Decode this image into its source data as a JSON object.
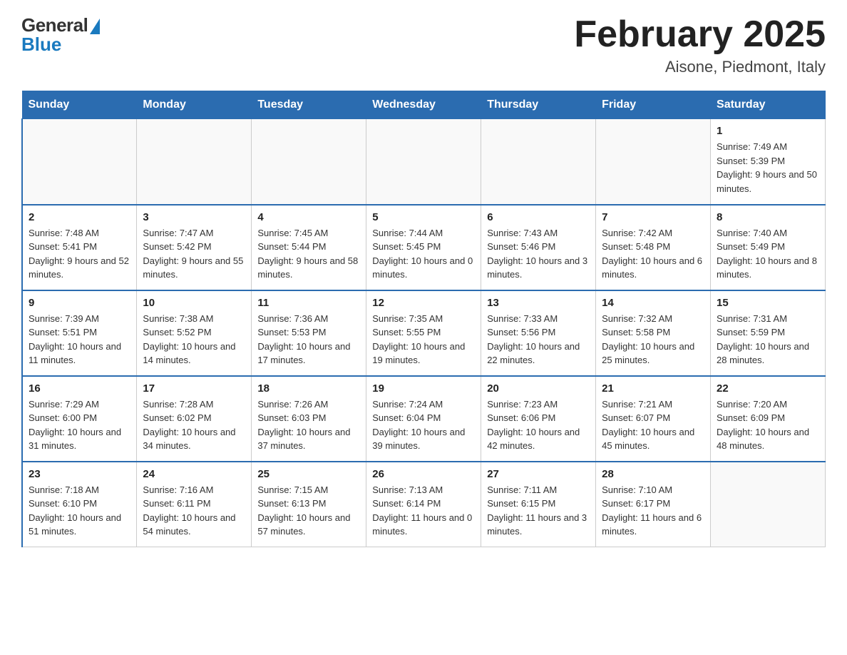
{
  "header": {
    "logo": {
      "general": "General",
      "blue": "Blue"
    },
    "title": "February 2025",
    "location": "Aisone, Piedmont, Italy"
  },
  "days_of_week": [
    "Sunday",
    "Monday",
    "Tuesday",
    "Wednesday",
    "Thursday",
    "Friday",
    "Saturday"
  ],
  "weeks": [
    [
      {
        "day": "",
        "info": ""
      },
      {
        "day": "",
        "info": ""
      },
      {
        "day": "",
        "info": ""
      },
      {
        "day": "",
        "info": ""
      },
      {
        "day": "",
        "info": ""
      },
      {
        "day": "",
        "info": ""
      },
      {
        "day": "1",
        "info": "Sunrise: 7:49 AM\nSunset: 5:39 PM\nDaylight: 9 hours and 50 minutes."
      }
    ],
    [
      {
        "day": "2",
        "info": "Sunrise: 7:48 AM\nSunset: 5:41 PM\nDaylight: 9 hours and 52 minutes."
      },
      {
        "day": "3",
        "info": "Sunrise: 7:47 AM\nSunset: 5:42 PM\nDaylight: 9 hours and 55 minutes."
      },
      {
        "day": "4",
        "info": "Sunrise: 7:45 AM\nSunset: 5:44 PM\nDaylight: 9 hours and 58 minutes."
      },
      {
        "day": "5",
        "info": "Sunrise: 7:44 AM\nSunset: 5:45 PM\nDaylight: 10 hours and 0 minutes."
      },
      {
        "day": "6",
        "info": "Sunrise: 7:43 AM\nSunset: 5:46 PM\nDaylight: 10 hours and 3 minutes."
      },
      {
        "day": "7",
        "info": "Sunrise: 7:42 AM\nSunset: 5:48 PM\nDaylight: 10 hours and 6 minutes."
      },
      {
        "day": "8",
        "info": "Sunrise: 7:40 AM\nSunset: 5:49 PM\nDaylight: 10 hours and 8 minutes."
      }
    ],
    [
      {
        "day": "9",
        "info": "Sunrise: 7:39 AM\nSunset: 5:51 PM\nDaylight: 10 hours and 11 minutes."
      },
      {
        "day": "10",
        "info": "Sunrise: 7:38 AM\nSunset: 5:52 PM\nDaylight: 10 hours and 14 minutes."
      },
      {
        "day": "11",
        "info": "Sunrise: 7:36 AM\nSunset: 5:53 PM\nDaylight: 10 hours and 17 minutes."
      },
      {
        "day": "12",
        "info": "Sunrise: 7:35 AM\nSunset: 5:55 PM\nDaylight: 10 hours and 19 minutes."
      },
      {
        "day": "13",
        "info": "Sunrise: 7:33 AM\nSunset: 5:56 PM\nDaylight: 10 hours and 22 minutes."
      },
      {
        "day": "14",
        "info": "Sunrise: 7:32 AM\nSunset: 5:58 PM\nDaylight: 10 hours and 25 minutes."
      },
      {
        "day": "15",
        "info": "Sunrise: 7:31 AM\nSunset: 5:59 PM\nDaylight: 10 hours and 28 minutes."
      }
    ],
    [
      {
        "day": "16",
        "info": "Sunrise: 7:29 AM\nSunset: 6:00 PM\nDaylight: 10 hours and 31 minutes."
      },
      {
        "day": "17",
        "info": "Sunrise: 7:28 AM\nSunset: 6:02 PM\nDaylight: 10 hours and 34 minutes."
      },
      {
        "day": "18",
        "info": "Sunrise: 7:26 AM\nSunset: 6:03 PM\nDaylight: 10 hours and 37 minutes."
      },
      {
        "day": "19",
        "info": "Sunrise: 7:24 AM\nSunset: 6:04 PM\nDaylight: 10 hours and 39 minutes."
      },
      {
        "day": "20",
        "info": "Sunrise: 7:23 AM\nSunset: 6:06 PM\nDaylight: 10 hours and 42 minutes."
      },
      {
        "day": "21",
        "info": "Sunrise: 7:21 AM\nSunset: 6:07 PM\nDaylight: 10 hours and 45 minutes."
      },
      {
        "day": "22",
        "info": "Sunrise: 7:20 AM\nSunset: 6:09 PM\nDaylight: 10 hours and 48 minutes."
      }
    ],
    [
      {
        "day": "23",
        "info": "Sunrise: 7:18 AM\nSunset: 6:10 PM\nDaylight: 10 hours and 51 minutes."
      },
      {
        "day": "24",
        "info": "Sunrise: 7:16 AM\nSunset: 6:11 PM\nDaylight: 10 hours and 54 minutes."
      },
      {
        "day": "25",
        "info": "Sunrise: 7:15 AM\nSunset: 6:13 PM\nDaylight: 10 hours and 57 minutes."
      },
      {
        "day": "26",
        "info": "Sunrise: 7:13 AM\nSunset: 6:14 PM\nDaylight: 11 hours and 0 minutes."
      },
      {
        "day": "27",
        "info": "Sunrise: 7:11 AM\nSunset: 6:15 PM\nDaylight: 11 hours and 3 minutes."
      },
      {
        "day": "28",
        "info": "Sunrise: 7:10 AM\nSunset: 6:17 PM\nDaylight: 11 hours and 6 minutes."
      },
      {
        "day": "",
        "info": ""
      }
    ]
  ]
}
